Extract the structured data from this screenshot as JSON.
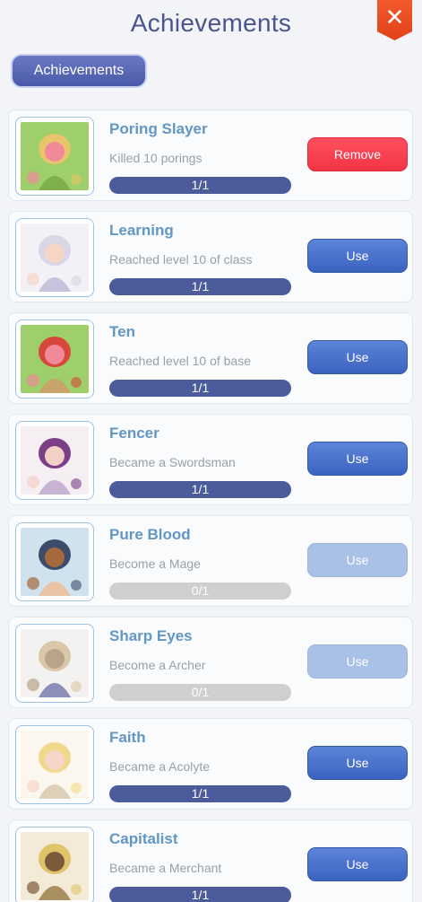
{
  "header": {
    "title": "Achievements",
    "close_icon": "close-icon",
    "close_glyph": "✕"
  },
  "tabs": [
    {
      "label": "Achievements",
      "selected": true
    }
  ],
  "achievements": [
    {
      "name": "Poring Slayer",
      "description": "Killed 10 porings",
      "progress_text": "1/1",
      "progress": 1,
      "action": "Remove",
      "action_state": "remove",
      "art": "chibi-green-hair-with-porings"
    },
    {
      "name": "Learning",
      "description": "Reached level 10 of class",
      "progress_text": "1/1",
      "progress": 1,
      "action": "Use",
      "action_state": "enabled",
      "art": "white-hair-girl"
    },
    {
      "name": "Ten",
      "description": "Reached level 10 of base",
      "progress_text": "1/1",
      "progress": 1,
      "action": "Use",
      "action_state": "enabled",
      "art": "chibi-red-hair-with-porings"
    },
    {
      "name": "Fencer",
      "description": "Became a Swordsman",
      "progress_text": "1/1",
      "progress": 1,
      "action": "Use",
      "action_state": "enabled",
      "art": "purple-hair-swordswoman"
    },
    {
      "name": "Pure Blood",
      "description": "Become a Mage",
      "progress_text": "0/1",
      "progress": 0,
      "action": "Use",
      "action_state": "disabled",
      "art": "mage-with-hat"
    },
    {
      "name": "Sharp Eyes",
      "description": "Become a Archer",
      "progress_text": "0/1",
      "progress": 0,
      "action": "Use",
      "action_state": "disabled",
      "art": "archer-girl"
    },
    {
      "name": "Faith",
      "description": "Became a Acolyte",
      "progress_text": "1/1",
      "progress": 1,
      "action": "Use",
      "action_state": "enabled",
      "art": "blonde-acolyte"
    },
    {
      "name": "Capitalist",
      "description": "Became a Merchant",
      "progress_text": "1/1",
      "progress": 1,
      "action": "Use",
      "action_state": "enabled",
      "art": "blonde-merchant"
    }
  ],
  "colors": {
    "title": "#4a5590",
    "name": "#6296c4",
    "progress_fill": "#4b5b9b",
    "progress_empty": "#cfcfd2",
    "use_button": "#3c62c0",
    "use_button_disabled": "#a9c1e6",
    "remove_button": "#f23545",
    "close_button": "#e0411a"
  }
}
